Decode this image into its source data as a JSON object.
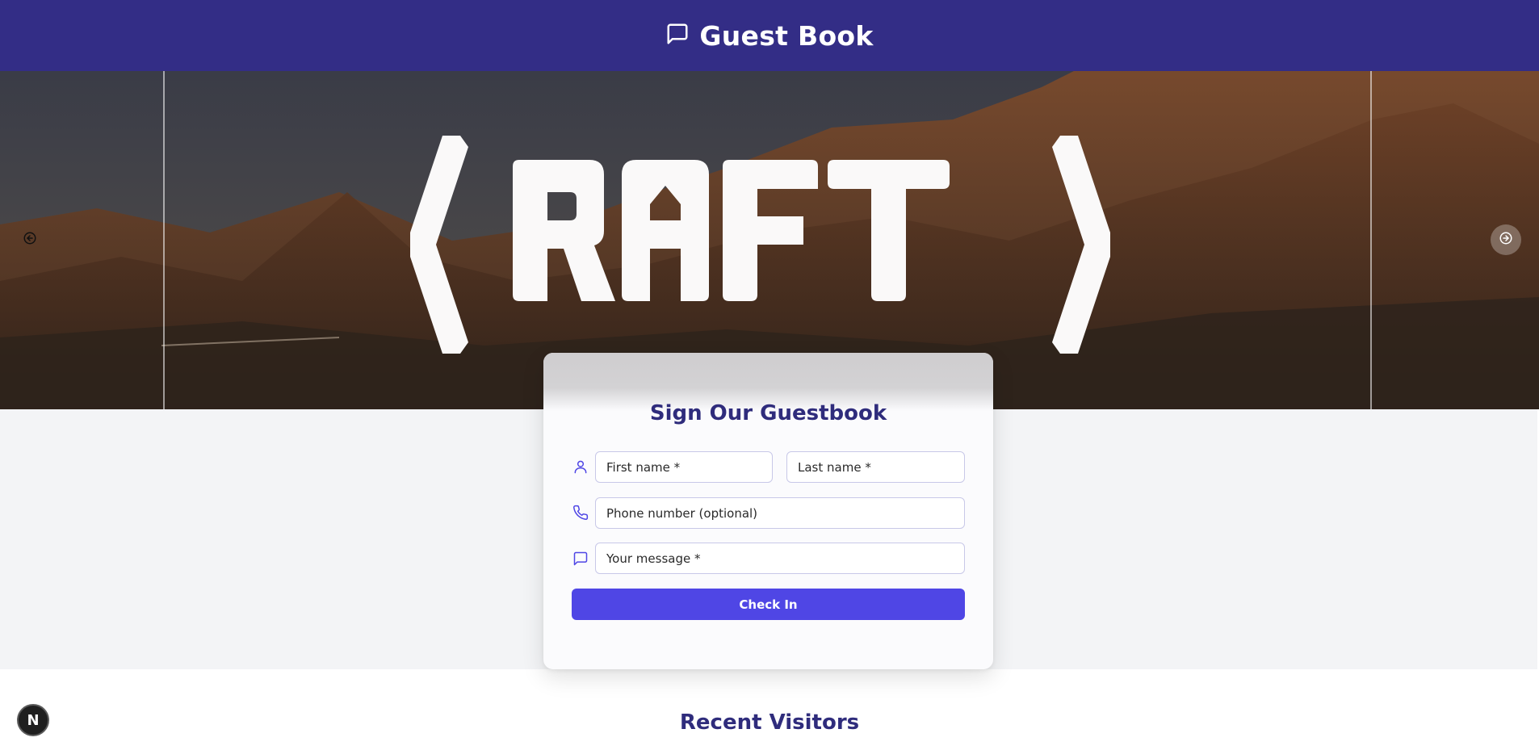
{
  "header": {
    "title": "Guest Book",
    "icon": "message-square-icon",
    "background": "#332d86"
  },
  "hero": {
    "logo_text": "(RAFT)",
    "prev_icon": "arrow-left-circle-icon",
    "next_icon": "arrow-right-circle-icon"
  },
  "form": {
    "title": "Sign Our Guestbook",
    "first_name_placeholder": "First name *",
    "last_name_placeholder": "Last name *",
    "phone_placeholder": "Phone number (optional)",
    "message_placeholder": "Your message *",
    "submit_label": "Check In",
    "accent": "#4f46e5",
    "title_color": "#2f2c7c"
  },
  "recent": {
    "title": "Recent Visitors"
  },
  "dev_badge": {
    "label": "N"
  }
}
